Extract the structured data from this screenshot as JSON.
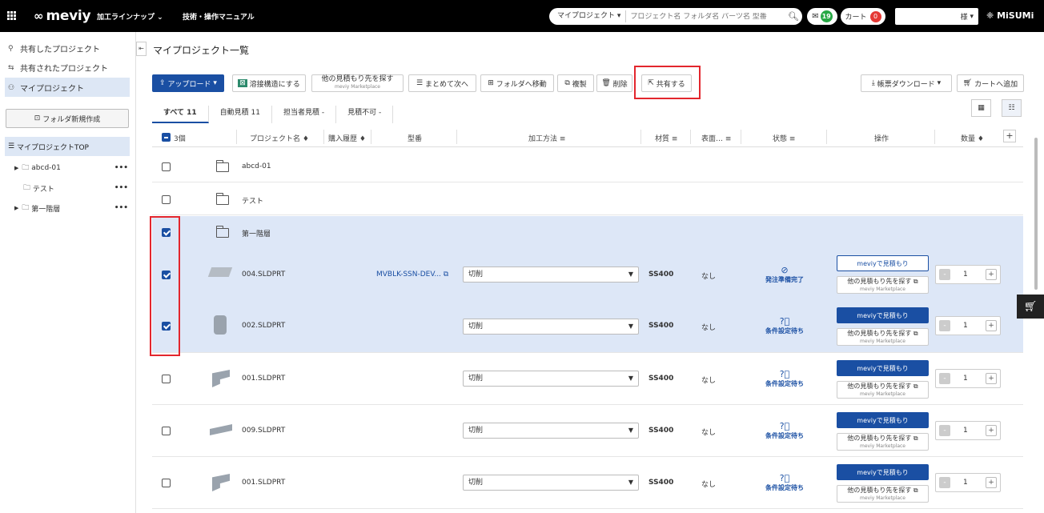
{
  "topbar": {
    "brand": "meviy",
    "nav_lineup": "加工ラインナップ",
    "nav_manual": "技術・操作マニュアル",
    "search_scope": "マイプロジェクト",
    "search_placeholder": "プロジェクト名 フォルダ名 パーツ名 型番",
    "mail_count": "19",
    "cart_label": "カート",
    "cart_count": "0",
    "user_suffix": "様",
    "misumi": "MiSUMi"
  },
  "sidebar": {
    "links": [
      "共有したプロジェクト",
      "共有されたプロジェクト",
      "マイプロジェクト"
    ],
    "new_folder": "フォルダ新規作成",
    "tree_top": "マイプロジェクトTOP",
    "tree_items": [
      {
        "label": "abcd-01",
        "expandable": true
      },
      {
        "label": "テスト",
        "expandable": false
      },
      {
        "label": "第一階層",
        "expandable": true
      }
    ],
    "dots": "•••"
  },
  "main": {
    "page_title": "マイプロジェクト一覧",
    "toolbar": {
      "upload": "アップロード",
      "weld": "溶接構造にする",
      "other_quote": "他の見積もり先を探す",
      "other_quote_sub": "meviy Marketplace",
      "bulk_next": "まとめて次へ",
      "move_folder": "フォルダへ移動",
      "copy": "複製",
      "delete": "削除",
      "share": "共有する",
      "download": "帳票ダウンロード",
      "add_cart": "カートへ追加"
    },
    "tabs": [
      "すべて 11",
      "自動見積 11",
      "担当者見積 -",
      "見積不可 -"
    ],
    "headers": {
      "select_count": "3個",
      "project_name": "プロジェクト名 ♦",
      "purchase": "購入履歴 ♦",
      "model": "型番",
      "method": "加工方法 ≡",
      "material": "材質 ≡",
      "surface": "表面… ≡",
      "status": "状態 ≡",
      "action": "操作",
      "quantity": "数量 ♦",
      "add_col": "+"
    },
    "folders": [
      {
        "name": "abcd-01",
        "checked": false
      },
      {
        "name": "テスト",
        "checked": false
      },
      {
        "name": "第一階層",
        "checked": true
      }
    ],
    "parts": [
      {
        "name": "004.SLDPRT",
        "model": "MVBLK-SSN-DEV...",
        "method": "切削",
        "material": "SS400",
        "surface": "なし",
        "status": "発注準備完了",
        "status_icon": "check-circle",
        "quote": "meviyで見積もり",
        "quote_style": "outline",
        "other": "他の見積もり先を探す",
        "other_sub": "meviy Marketplace",
        "qty": "1",
        "checked": true
      },
      {
        "name": "002.SLDPRT",
        "model": "",
        "method": "切削",
        "material": "SS400",
        "surface": "なし",
        "status": "条件設定待ち",
        "status_icon": "question-circle",
        "quote": "meviyで見積もり",
        "quote_style": "fill",
        "other": "他の見積もり先を探す",
        "other_sub": "meviy Marketplace",
        "qty": "1",
        "checked": true
      },
      {
        "name": "001.SLDPRT",
        "model": "",
        "method": "切削",
        "material": "SS400",
        "surface": "なし",
        "status": "条件設定待ち",
        "status_icon": "question-circle",
        "quote": "meviyで見積もり",
        "quote_style": "fill",
        "other": "他の見積もり先を探す",
        "other_sub": "meviy Marketplace",
        "qty": "1",
        "checked": false
      },
      {
        "name": "009.SLDPRT",
        "model": "",
        "method": "切削",
        "material": "SS400",
        "surface": "なし",
        "status": "条件設定待ち",
        "status_icon": "question-circle",
        "quote": "meviyで見積もり",
        "quote_style": "fill",
        "other": "他の見積もり先を探す",
        "other_sub": "meviy Marketplace",
        "qty": "1",
        "checked": false
      },
      {
        "name": "001.SLDPRT",
        "model": "",
        "method": "切削",
        "material": "SS400",
        "surface": "なし",
        "status": "条件設定待ち",
        "status_icon": "question-circle",
        "quote": "meviyで見積もり",
        "quote_style": "fill",
        "other": "他の見積もり先を探す",
        "other_sub": "meviy Marketplace",
        "qty": "1",
        "checked": false
      }
    ]
  },
  "colors": {
    "topbar": "#000000",
    "primary": "#1a4fa3",
    "selected_row": "#dde7f7",
    "highlight": "#e3262d",
    "badge_green": "#27a844",
    "badge_red": "#e53935"
  }
}
